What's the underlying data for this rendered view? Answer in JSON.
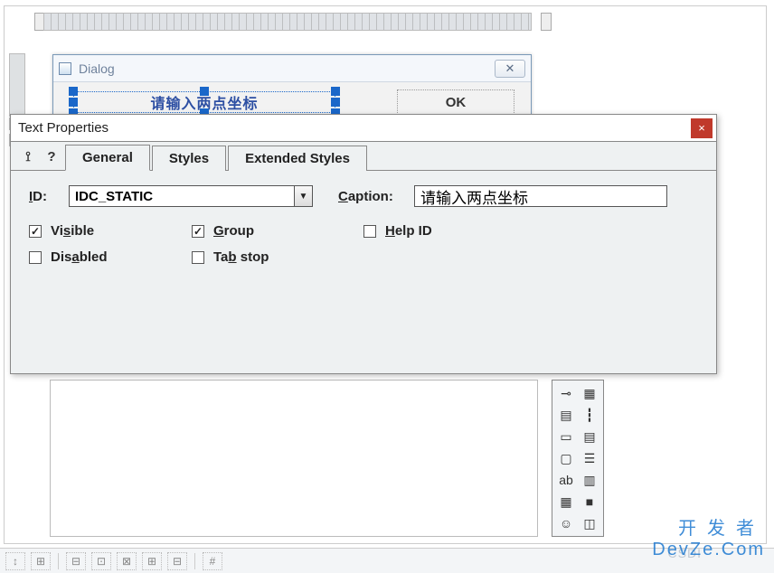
{
  "dialog_preview": {
    "title": "Dialog",
    "close_glyph": "✕",
    "static_text": "请输入两点坐标",
    "ok_label": "OK"
  },
  "props": {
    "title": "Text Properties",
    "close_glyph": "×",
    "pin_glyph": "⟟",
    "help_glyph": "?",
    "tabs": {
      "general": "General",
      "styles": "Styles",
      "extended": "Extended Styles"
    },
    "id_label_pre": "I",
    "id_label_post": "D:",
    "id_value": "IDC_STATIC",
    "caption_label_pre": "C",
    "caption_label_post": "aption:",
    "caption_value": "请输入两点坐标",
    "checks": {
      "visible_pre": "Vi",
      "visible_u": "s",
      "visible_post": "ible",
      "visible_checked": true,
      "group_u": "G",
      "group_post": "roup",
      "group_checked": true,
      "help_u": "H",
      "help_post": "elp ID",
      "help_checked": false,
      "disabled_pre": "Dis",
      "disabled_u": "a",
      "disabled_post": "bled",
      "disabled_checked": false,
      "tabstop_pre": "Ta",
      "tabstop_u": "b",
      "tabstop_post": " stop",
      "tabstop_checked": false
    }
  },
  "toolbox": {
    "items": [
      [
        "⊸",
        "▦"
      ],
      [
        "▤",
        "┇"
      ],
      [
        "▭",
        "▤"
      ],
      [
        "▢",
        "☰"
      ],
      [
        "ab",
        "▥"
      ],
      [
        "▦",
        "■"
      ],
      [
        "☺",
        "◫"
      ]
    ]
  },
  "bottom_tools": [
    "↕",
    "⊞",
    "⊟",
    "⊡",
    "⊠",
    "⊞",
    "⊟",
    "#"
  ],
  "watermark": {
    "line1": "开发者",
    "line2": "DevZe.Com",
    "faint": "CSDI"
  }
}
